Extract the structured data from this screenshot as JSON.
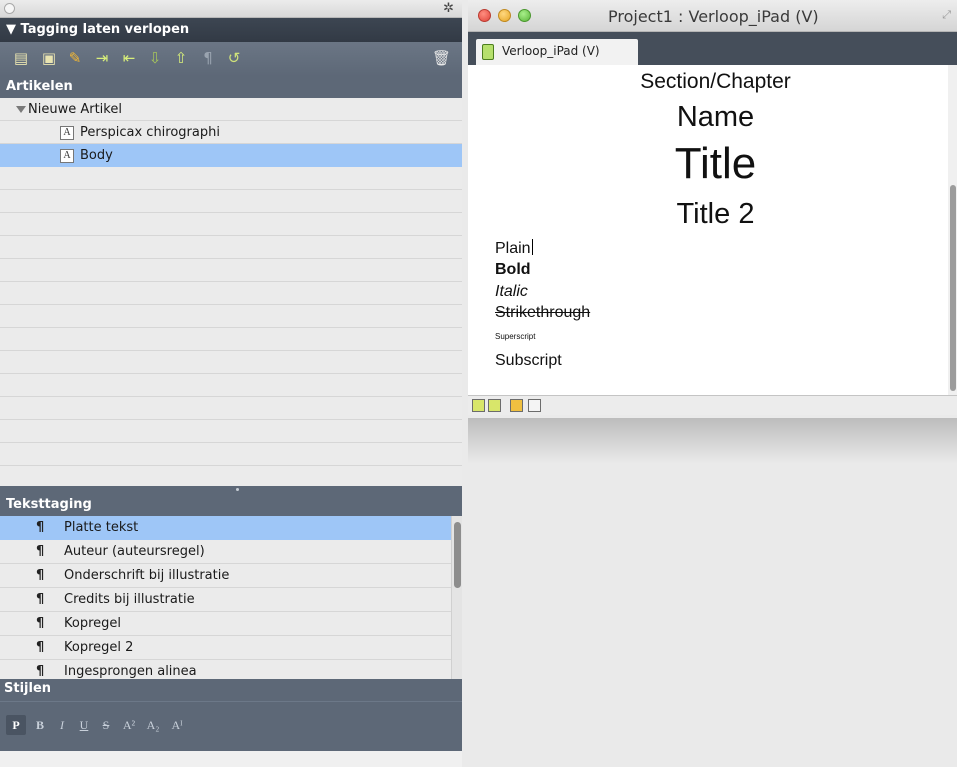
{
  "palette": {
    "section_title": "▼ Tagging laten verlopen",
    "toolbar_icons": [
      "add-article-icon",
      "add-component-icon",
      "edit-pencil-icon",
      "import-icon",
      "export-icon",
      "move-down-icon",
      "move-up-icon",
      "paragraph-icon",
      "refresh-icon",
      "trash-icon"
    ],
    "articles_header": "Artikelen",
    "tree": {
      "root": "Nieuwe Artikel",
      "children": [
        "Perspicax chirographi",
        "Body"
      ],
      "selected": "Body"
    },
    "teksttaging": {
      "header": "Teksttaging",
      "items": [
        "Platte tekst",
        "Auteur (auteursregel)",
        "Onderschrift bij illustratie",
        "Credits bij illustratie",
        "Kopregel",
        "Kopregel 2",
        "Ingesprongen alinea"
      ],
      "selected": "Platte tekst"
    },
    "stijlen": {
      "header": "Stijlen",
      "buttons": [
        "P",
        "B",
        "I",
        "U",
        "S",
        "A²",
        "A₂",
        "Aᴵ"
      ]
    }
  },
  "window": {
    "title": "Project1 : Verloop_iPad (V)",
    "tab_label": "Verloop_iPad (V)",
    "content": {
      "section": "Section/Chapter",
      "name": "Name",
      "title": "Title",
      "title2": "Title 2",
      "plain": "Plain",
      "bold": "Bold",
      "italic": "Italic",
      "strike": "Strikethrough",
      "superscript": "Superscript",
      "subscript": "Subscript"
    }
  },
  "colors": {
    "dark_panel": "#5d6877",
    "selection": "#9ec6f7"
  }
}
